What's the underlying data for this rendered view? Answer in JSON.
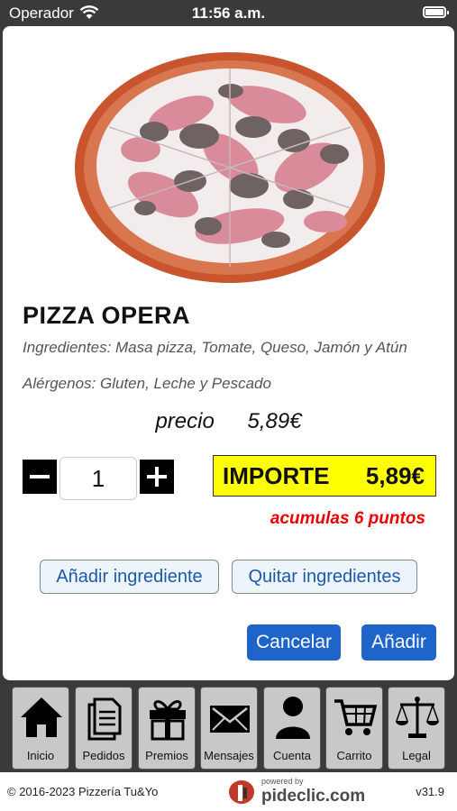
{
  "status_bar": {
    "carrier": "Operador",
    "time": "11:56 a.m."
  },
  "product": {
    "title": "PIZZA OPERA",
    "ingredients": "Ingredientes: Masa pizza, Tomate, Queso, Jamón y Atún",
    "allergens": "Alérgenos: Gluten, Leche y Pescado",
    "price_label": "precio",
    "price": "5,89€"
  },
  "order": {
    "quantity": "1",
    "total_label": "IMPORTE",
    "total": "5,89€",
    "points_text": "acumulas 6 puntos"
  },
  "buttons": {
    "add_ingredient": "Añadir ingrediente",
    "remove_ingredients": "Quitar ingredientes",
    "cancel": "Cancelar",
    "add": "Añadir"
  },
  "nav": {
    "items": [
      {
        "label": "Inicio",
        "icon": "home-icon"
      },
      {
        "label": "Pedidos",
        "icon": "document-icon"
      },
      {
        "label": "Premios",
        "icon": "gift-icon"
      },
      {
        "label": "Mensajes",
        "icon": "envelope-icon"
      },
      {
        "label": "Cuenta",
        "icon": "user-icon"
      },
      {
        "label": "Carrito",
        "icon": "cart-icon"
      },
      {
        "label": "Legal",
        "icon": "scales-icon"
      }
    ]
  },
  "footer": {
    "copyright": "© 2016-2023  Pizzería Tu&Yo",
    "powered_by": "powered by",
    "brand": "pideclic.com",
    "version": "v31.9"
  },
  "colors": {
    "primary_button": "#1f64c8",
    "total_highlight": "#ffff00",
    "points_text": "#e00000"
  }
}
